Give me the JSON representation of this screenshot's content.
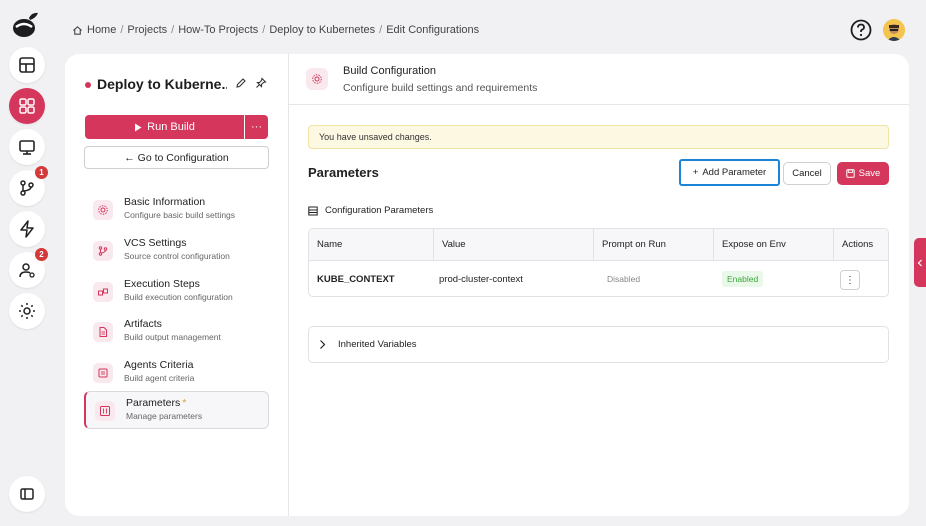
{
  "breadcrumb": {
    "items": [
      "Home",
      "Projects",
      "How-To Projects",
      "Deploy to Kubernetes",
      "Edit Configurations"
    ],
    "separator": "/"
  },
  "rail": {
    "icons": [
      "logo-icon",
      "dashboard-icon",
      "apps-icon",
      "monitor-icon",
      "branch-icon",
      "lightning-icon",
      "user-settings-icon",
      "gear-icon",
      "sidebar-toggle-icon"
    ],
    "badges": {
      "branch": "1",
      "users": "2"
    }
  },
  "sidebar": {
    "project_title": "Deploy to Kuberne...",
    "run_build_label": "Run Build",
    "more_label": "···",
    "goto_label": "← Go to Configuration",
    "items": [
      {
        "title": "Basic Information",
        "subtitle": "Configure basic build settings"
      },
      {
        "title": "VCS Settings",
        "subtitle": "Source control configuration"
      },
      {
        "title": "Execution Steps",
        "subtitle": "Build execution configuration"
      },
      {
        "title": "Artifacts",
        "subtitle": "Build output management"
      },
      {
        "title": "Agents Criteria",
        "subtitle": "Build agent criteria"
      },
      {
        "title": "Parameters",
        "subtitle": "Manage parameters",
        "modified_marker": "*"
      }
    ]
  },
  "header": {
    "title": "Build Configuration",
    "subtitle": "Configure build settings and requirements"
  },
  "main": {
    "warning": "You have unsaved changes.",
    "params_title": "Parameters",
    "add_parameter_label": "Add Parameter",
    "cancel_label": "Cancel",
    "save_label": "Save",
    "config_params_label": "Configuration Parameters",
    "table": {
      "headers": [
        "Name",
        "Value",
        "Prompt on Run",
        "Expose on Env",
        "Actions"
      ],
      "rows": [
        {
          "name": "KUBE_CONTEXT",
          "value": "prod-cluster-context",
          "prompt": "Disabled",
          "expose": "Enabled",
          "actions": "⋮"
        }
      ]
    },
    "inherited_label": "Inherited Variables"
  },
  "colors": {
    "accent": "#d4365c",
    "focus_outline": "#1c84d6",
    "warning_bg": "#fdf8e1",
    "enabled_text": "#3aa63a"
  }
}
